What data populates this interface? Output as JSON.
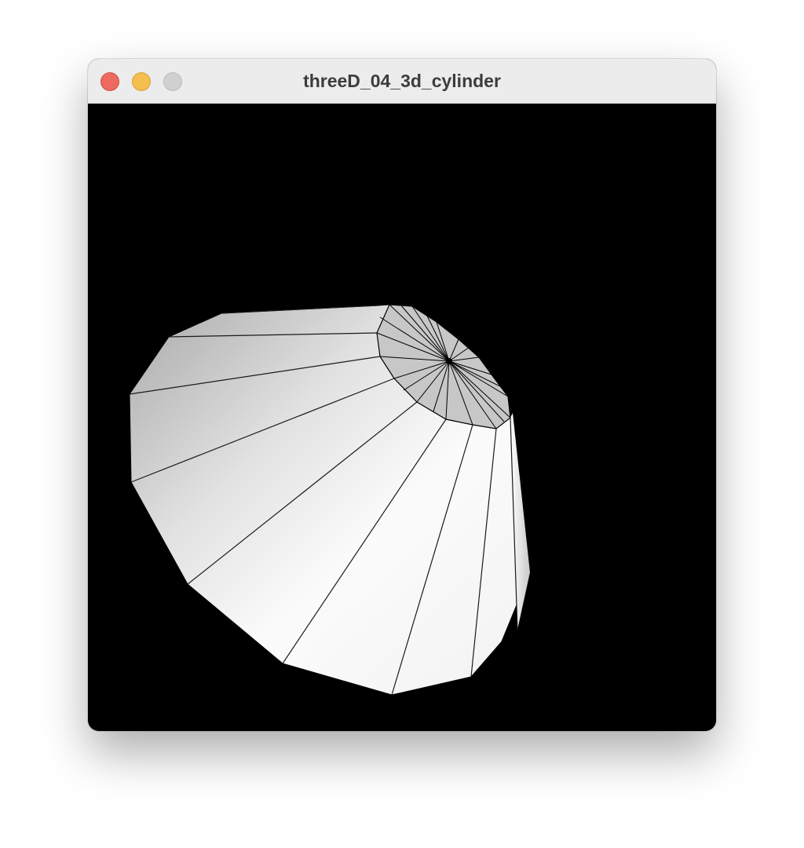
{
  "window": {
    "title": "threeD_04_3d_cylinder",
    "controls": {
      "close_color": "#ec6a5f",
      "minimize_color": "#f4bf4f",
      "zoom_color": "#d0d0d0"
    }
  },
  "viewport": {
    "background": "#000000",
    "object": "cylinder",
    "surface_color": "#ffffff",
    "edge_color": "#000000"
  }
}
